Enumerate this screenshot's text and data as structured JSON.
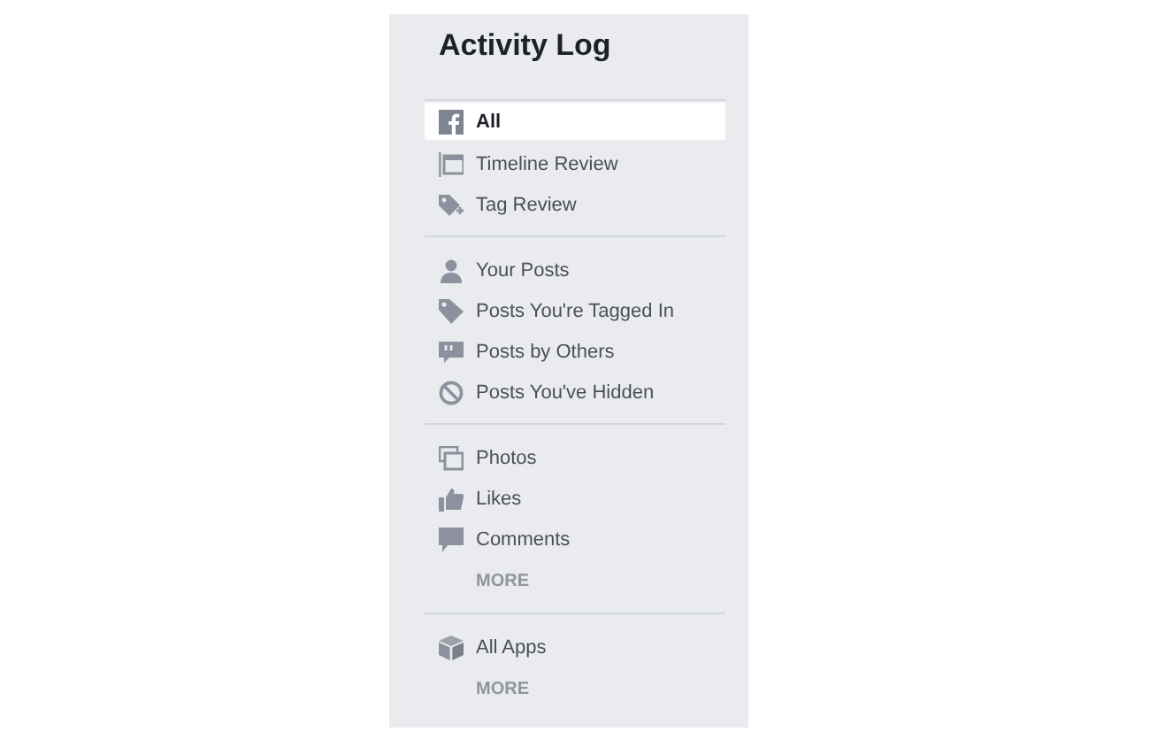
{
  "title": "Activity Log",
  "sections": [
    {
      "items": [
        {
          "kind": "item",
          "label": "All",
          "selected": true
        },
        {
          "kind": "item",
          "label": "Timeline Review",
          "selected": false
        },
        {
          "kind": "item",
          "label": "Tag Review",
          "selected": false
        }
      ]
    },
    {
      "items": [
        {
          "kind": "item",
          "label": "Your Posts",
          "selected": false
        },
        {
          "kind": "item",
          "label": "Posts You're Tagged In",
          "selected": false
        },
        {
          "kind": "item",
          "label": "Posts by Others",
          "selected": false
        },
        {
          "kind": "item",
          "label": "Posts You've Hidden",
          "selected": false
        }
      ]
    },
    {
      "items": [
        {
          "kind": "item",
          "label": "Photos",
          "selected": false
        },
        {
          "kind": "item",
          "label": "Likes",
          "selected": false
        },
        {
          "kind": "item",
          "label": "Comments",
          "selected": false
        },
        {
          "kind": "more",
          "label": "MORE"
        }
      ]
    },
    {
      "items": [
        {
          "kind": "item",
          "label": "All Apps",
          "selected": false
        },
        {
          "kind": "more",
          "label": "MORE"
        }
      ]
    }
  ]
}
